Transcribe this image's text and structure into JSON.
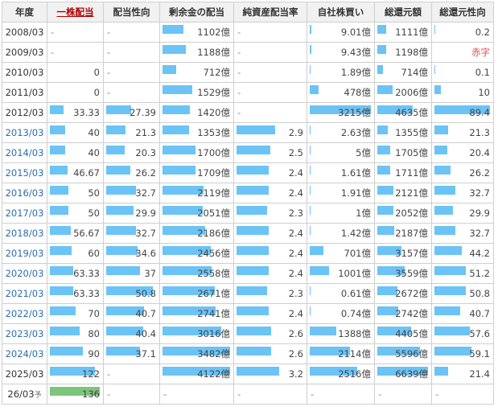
{
  "headers": [
    "年度",
    "一株配当",
    "配当性向",
    "剰余金の配当",
    "純資産配当率",
    "自社株買い",
    "総還元額",
    "総還元性向"
  ],
  "rows": [
    {
      "year": "2008/03",
      "link": false,
      "cells": [
        "-",
        "-",
        "1102億",
        "-",
        "9.01億",
        "1111億",
        "0.2"
      ]
    },
    {
      "year": "2009/03",
      "link": false,
      "cells": [
        "-",
        "-",
        "1188億",
        "-",
        "9.43億",
        "1198億",
        "赤字"
      ]
    },
    {
      "year": "2010/03",
      "link": false,
      "cells": [
        "0",
        "-",
        "712億",
        "-",
        "1.89億",
        "714億",
        "0.1"
      ]
    },
    {
      "year": "2011/03",
      "link": false,
      "cells": [
        "0",
        "-",
        "1529億",
        "-",
        "478億",
        "2006億",
        "10"
      ]
    },
    {
      "year": "2012/03",
      "link": false,
      "cells": [
        "33.33",
        "27.39",
        "1420億",
        "-",
        "3215億",
        "4635億",
        "89.4"
      ]
    },
    {
      "year": "2013/03",
      "link": true,
      "cells": [
        "40",
        "21.3",
        "1353億",
        "2.9",
        "2.63億",
        "1355億",
        "21.3"
      ]
    },
    {
      "year": "2014/03",
      "link": true,
      "cells": [
        "40",
        "20.3",
        "1700億",
        "2.5",
        "5億",
        "1705億",
        "20.4"
      ]
    },
    {
      "year": "2015/03",
      "link": true,
      "cells": [
        "46.67",
        "26.2",
        "1709億",
        "2.4",
        "1.61億",
        "1711億",
        "26.2"
      ]
    },
    {
      "year": "2016/03",
      "link": true,
      "cells": [
        "50",
        "32.7",
        "2119億",
        "2.4",
        "1.91億",
        "2121億",
        "32.7"
      ]
    },
    {
      "year": "2017/03",
      "link": true,
      "cells": [
        "50",
        "29.9",
        "2051億",
        "2.3",
        "1億",
        "2052億",
        "29.9"
      ]
    },
    {
      "year": "2018/03",
      "link": true,
      "cells": [
        "56.67",
        "32.7",
        "2186億",
        "2.4",
        "1.42億",
        "2187億",
        "32.7"
      ]
    },
    {
      "year": "2019/03",
      "link": true,
      "cells": [
        "60",
        "34.6",
        "2456億",
        "2.4",
        "701億",
        "3157億",
        "44.2"
      ]
    },
    {
      "year": "2020/03",
      "link": true,
      "cells": [
        "63.33",
        "37",
        "2558億",
        "2.4",
        "1001億",
        "3559億",
        "51.2"
      ]
    },
    {
      "year": "2021/03",
      "link": true,
      "cells": [
        "63.33",
        "50.8",
        "2671億",
        "2.3",
        "0.61億",
        "2672億",
        "50.8"
      ]
    },
    {
      "year": "2022/03",
      "link": true,
      "cells": [
        "70",
        "40.7",
        "2741億",
        "2.4",
        "0.74億",
        "2742億",
        "40.7"
      ]
    },
    {
      "year": "2023/03",
      "link": true,
      "cells": [
        "80",
        "40.4",
        "3016億",
        "2.6",
        "1388億",
        "4405億",
        "57.6"
      ]
    },
    {
      "year": "2024/03",
      "link": true,
      "cells": [
        "90",
        "37.1",
        "3482億",
        "2.6",
        "2114億",
        "5596億",
        "59.1"
      ]
    },
    {
      "year": "2025/03",
      "link": false,
      "cells": [
        "122",
        "-",
        "4122億",
        "3.2",
        "2516億",
        "6639億",
        "21.4"
      ]
    },
    {
      "year": "26/03",
      "suffix": "予",
      "link": false,
      "cells": [
        "136",
        "-",
        "-",
        "-",
        "-",
        "-",
        "-"
      ]
    }
  ],
  "bars": [
    [
      null,
      null,
      0.31,
      null,
      0.02,
      0.17,
      0.01
    ],
    [
      null,
      null,
      0.34,
      null,
      0.02,
      0.18,
      null
    ],
    [
      null,
      null,
      0.2,
      null,
      0.01,
      0.11,
      0.01
    ],
    [
      null,
      null,
      0.44,
      null,
      0.15,
      0.3,
      0.11
    ],
    [
      0.27,
      0.5,
      0.41,
      null,
      1.0,
      0.7,
      1.0
    ],
    [
      0.3,
      0.39,
      0.39,
      0.58,
      0.01,
      0.2,
      0.24
    ],
    [
      0.3,
      0.37,
      0.49,
      0.5,
      0.01,
      0.26,
      0.23
    ],
    [
      0.35,
      0.48,
      0.49,
      0.48,
      0.01,
      0.26,
      0.29
    ],
    [
      0.37,
      0.6,
      0.61,
      0.48,
      0.01,
      0.32,
      0.37
    ],
    [
      0.37,
      0.55,
      0.59,
      0.46,
      0.01,
      0.31,
      0.33
    ],
    [
      0.42,
      0.6,
      0.63,
      0.48,
      0.01,
      0.33,
      0.37
    ],
    [
      0.44,
      0.63,
      0.71,
      0.48,
      0.22,
      0.48,
      0.49
    ],
    [
      0.47,
      0.68,
      0.73,
      0.48,
      0.31,
      0.54,
      0.57
    ],
    [
      0.47,
      0.93,
      0.77,
      0.46,
      0.01,
      0.4,
      0.57
    ],
    [
      0.52,
      0.75,
      0.79,
      0.48,
      0.01,
      0.41,
      0.46
    ],
    [
      0.59,
      0.74,
      0.87,
      0.52,
      0.43,
      0.66,
      0.64
    ],
    [
      0.66,
      0.68,
      1.0,
      0.52,
      0.66,
      0.84,
      0.66
    ],
    [
      0.9,
      null,
      1.0,
      0.64,
      0.78,
      1.0,
      0.24
    ],
    [
      1.0,
      null,
      null,
      null,
      null,
      null,
      null
    ]
  ],
  "colors": {
    "bar": "#6cc3f5",
    "forecast_bar": "#7dc57a",
    "deficit_text": "#d9534f",
    "active_header": "#b00000"
  }
}
